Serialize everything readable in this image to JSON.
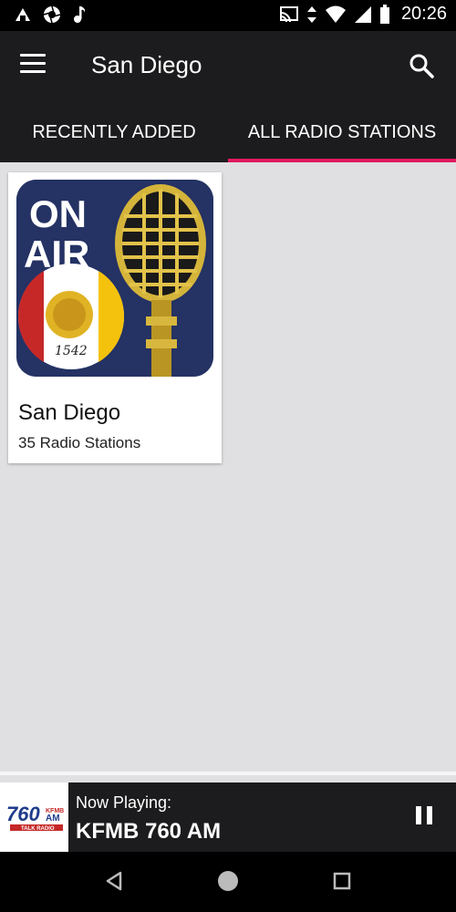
{
  "status_bar": {
    "time": "20:26",
    "left_icons": [
      "notification-icon",
      "camera-aperture-icon",
      "music-note-icon"
    ],
    "right_icons": [
      "cast-icon",
      "data-arrows-icon",
      "wifi-icon",
      "signal-icon",
      "battery-icon"
    ]
  },
  "app_bar": {
    "title": "San Diego",
    "menu_icon": "hamburger-menu-icon",
    "search_icon": "search-icon"
  },
  "tabs": [
    {
      "label": "RECENTLY ADDED",
      "active": false
    },
    {
      "label": "ALL RADIO STATIONS",
      "active": true
    }
  ],
  "cards": [
    {
      "title": "San Diego",
      "subtitle": "35 Radio Stations",
      "image_text_line1": "ON",
      "image_text_line2": "AIR",
      "seal_year": "1542"
    }
  ],
  "now_playing": {
    "label": "Now Playing:",
    "station": "KFMB 760 AM",
    "logo_number": "760",
    "logo_band": "AM",
    "logo_call": "KFMB",
    "logo_tagline": "TALK RADIO"
  },
  "colors": {
    "accent": "#e0195f",
    "app_bar": "#1c1c1e",
    "background": "#e0dfe2",
    "card_image_bg": "#243264"
  }
}
